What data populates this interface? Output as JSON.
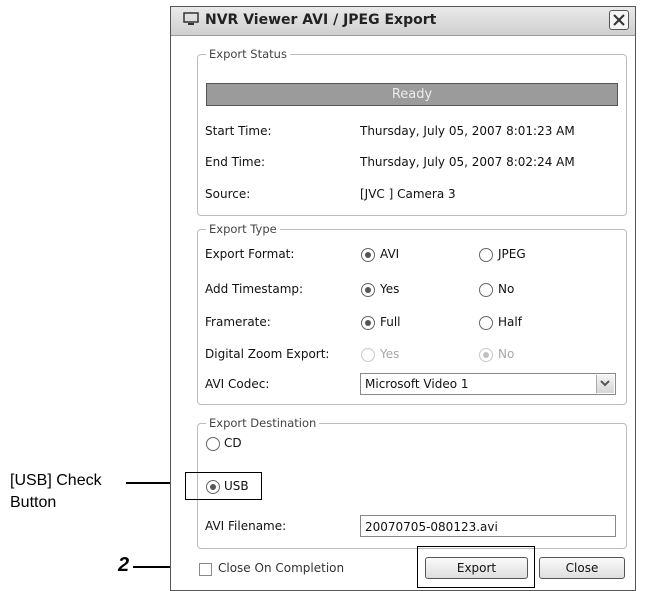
{
  "window": {
    "title": "NVR Viewer AVI / JPEG Export",
    "icon": "nvr-app-icon"
  },
  "export_status": {
    "legend": "Export Status",
    "status_text": "Ready",
    "start_time": {
      "label": "Start Time:",
      "value": "Thursday, July 05, 2007 8:01:23 AM"
    },
    "end_time": {
      "label": "End Time:",
      "value": "Thursday, July 05, 2007 8:02:24 AM"
    },
    "source": {
      "label": "Source:",
      "value": "[JVC ] Camera 3"
    }
  },
  "export_type": {
    "legend": "Export Type",
    "format": {
      "label": "Export Format:",
      "options": [
        "AVI",
        "JPEG"
      ],
      "selected": "AVI"
    },
    "timestamp": {
      "label": "Add Timestamp:",
      "options": [
        "Yes",
        "No"
      ],
      "selected": "Yes"
    },
    "framerate": {
      "label": "Framerate:",
      "options": [
        "Full",
        "Half"
      ],
      "selected": "Full"
    },
    "digital_zoom": {
      "label": "Digital Zoom Export:",
      "options": [
        "Yes",
        "No"
      ],
      "selected": "No",
      "disabled": true
    },
    "codec": {
      "label": "AVI Codec:",
      "value": "Microsoft Video 1"
    }
  },
  "export_destination": {
    "legend": "Export Destination",
    "options": [
      "CD",
      "USB"
    ],
    "selected": "USB",
    "filename": {
      "label": "AVI Filename:",
      "value": "20070705-080123.avi"
    }
  },
  "footer": {
    "close_on_completion_label": "Close On Completion",
    "close_on_completion_checked": false,
    "export_button": "Export",
    "close_button": "Close"
  },
  "annotations": {
    "usb_callout": [
      "[USB] Check",
      "Button"
    ],
    "step_number": "2"
  }
}
